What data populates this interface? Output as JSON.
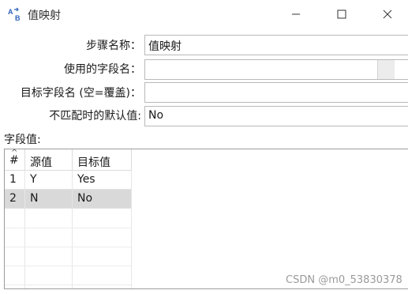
{
  "window": {
    "title": "值映射",
    "icon": "value-mapper-icon",
    "controls": [
      "minimize-icon",
      "maximize-icon",
      "close-icon"
    ]
  },
  "form": {
    "step_name_label": "步骤名称：",
    "step_name_value": "值映射",
    "field_to_use_label": "使用的字段名：",
    "field_to_use_value": "",
    "target_field_label": "目标字段名 (空=覆盖)：",
    "target_field_value": "",
    "default_label": "不匹配时的默认值:",
    "default_value": "No"
  },
  "field_values": {
    "label": "字段值:",
    "columns": [
      "#",
      "源值",
      "目标值"
    ],
    "sort_indicator": "^",
    "rows": [
      {
        "num": "1",
        "source": "Y",
        "target": "Yes"
      },
      {
        "num": "2",
        "source": "N",
        "target": "No"
      }
    ],
    "selected_row": 1
  },
  "watermark": "CSDN @m0_53830378",
  "colors": {
    "selected_row_bg": "#d9d9d9",
    "border": "#b9b9b9"
  }
}
